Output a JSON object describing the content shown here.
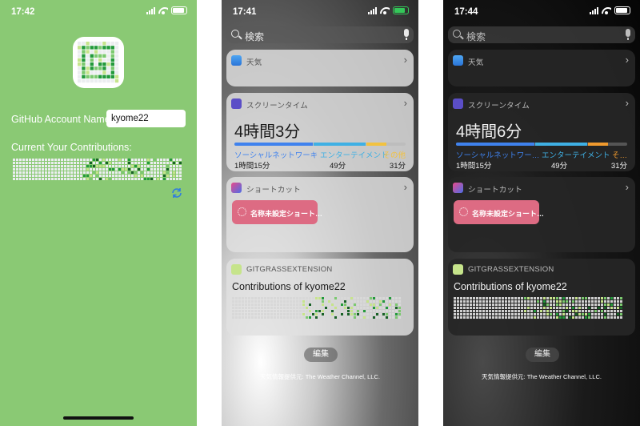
{
  "phone1": {
    "time": "17:42",
    "account_label": "GitHub Account Name:",
    "account_value": "kyome22",
    "contributions_label": "Current Your Contributions:",
    "bg_color": "#8ac974"
  },
  "phone2": {
    "time": "17:41",
    "search_placeholder": "検索",
    "weather_title": "天気",
    "screentime_title": "スクリーンタイム",
    "screentime_total": "4時間3分",
    "categories": [
      {
        "label": "ソーシャルネットワーキング",
        "time": "1時間15分",
        "share": 0.46,
        "color": "#3f82ee"
      },
      {
        "label": "エンターテイメント",
        "time": "49分",
        "share": 0.3,
        "color": "#3fb0e4"
      },
      {
        "label": "その他",
        "time": "31分",
        "share": 0.12,
        "color": "#f2c240"
      }
    ],
    "shortcut_title": "ショートカット",
    "shortcut_button": "名称未設定ショート…",
    "gg_title": "GITGRASSEXTENSION",
    "gg_heading": "Contributions of kyome22",
    "edit": "編集",
    "footer": "天気情報提供元: The Weather Channel, LLC."
  },
  "phone3": {
    "time": "17:44",
    "search_placeholder": "検索",
    "weather_title": "天気",
    "screentime_title": "スクリーンタイム",
    "screentime_total": "4時間6分",
    "categories": [
      {
        "label": "ソーシャルネットワー…",
        "time": "1時間15分",
        "share": 0.46,
        "color": "#3f82ee"
      },
      {
        "label": "エンターテイメント",
        "time": "49分",
        "share": 0.3,
        "color": "#3fb0e4"
      },
      {
        "label": "そ…",
        "time": "31分",
        "share": 0.12,
        "color": "#f09a2e"
      }
    ],
    "shortcut_title": "ショートカット",
    "shortcut_button": "名称未設定ショート…",
    "gg_title": "GITGRASSEXTENSION",
    "gg_heading": "Contributions of kyome22",
    "edit": "編集",
    "footer": "天気情報提供元: The Weather Channel, LLC."
  },
  "icons": {
    "search": "search-icon",
    "mic": "mic-icon",
    "weather": "weather-icon",
    "screentime": "hourglass-icon",
    "shortcuts": "shortcuts-icon",
    "gitgrass": "gitgrass-icon",
    "refresh": "refresh-icon",
    "chevron": "chevron-right-icon"
  },
  "colors": {
    "grass_levels": [
      "#ebedf0",
      "#c6e48b",
      "#7bc96f",
      "#239a3b",
      "#196127"
    ],
    "shortcut_button": "#dd6b83"
  }
}
